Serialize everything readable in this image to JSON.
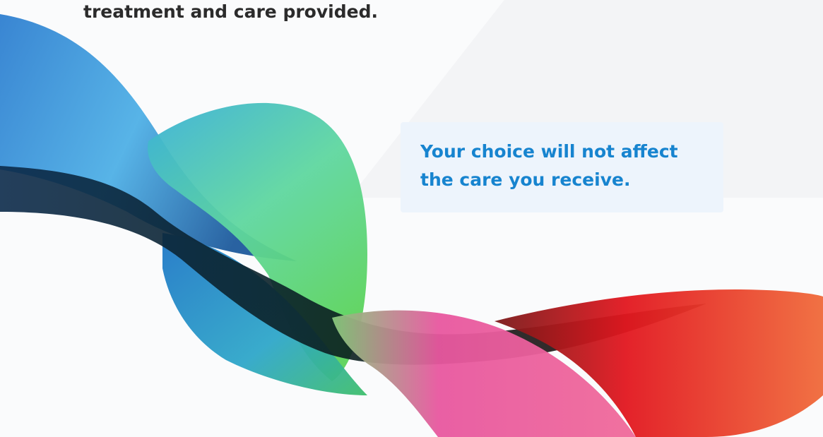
{
  "slide": {
    "top_text": "treatment and care provided.",
    "callout_line1": "Your choice will not affect",
    "callout_line2": "the care you receive."
  },
  "colors": {
    "heading_text": "#2b2b2b",
    "callout_text": "#1784cf",
    "callout_background": "#ecf3fc",
    "wave_blue": "#2f86d3",
    "wave_green": "#59d36f",
    "wave_pink": "#ea4f9e",
    "wave_red": "#e0151e"
  }
}
